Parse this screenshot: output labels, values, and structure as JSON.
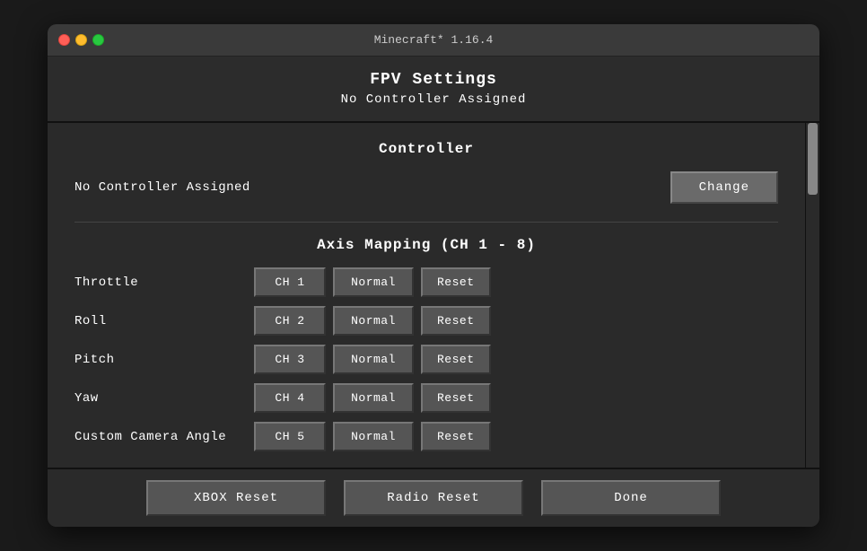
{
  "window": {
    "title": "Minecraft* 1.16.4"
  },
  "header": {
    "title": "FPV Settings",
    "subtitle": "No Controller Assigned"
  },
  "controller": {
    "section_title": "Controller",
    "assigned_label": "No Controller Assigned",
    "change_button": "Change"
  },
  "axis_mapping": {
    "section_title": "Axis Mapping (CH 1 - 8)",
    "rows": [
      {
        "label": "Throttle",
        "ch": "CH 1",
        "normal": "Normal",
        "reset": "Reset"
      },
      {
        "label": "Roll",
        "ch": "CH 2",
        "normal": "Normal",
        "reset": "Reset"
      },
      {
        "label": "Pitch",
        "ch": "CH 3",
        "normal": "Normal",
        "reset": "Reset"
      },
      {
        "label": "Yaw",
        "ch": "CH 4",
        "normal": "Normal",
        "reset": "Reset"
      },
      {
        "label": "Custom Camera Angle",
        "ch": "CH 5",
        "normal": "Normal",
        "reset": "Reset"
      }
    ]
  },
  "bottom_buttons": {
    "xbox_reset": "XBOX Reset",
    "radio_reset": "Radio Reset",
    "done": "Done"
  }
}
